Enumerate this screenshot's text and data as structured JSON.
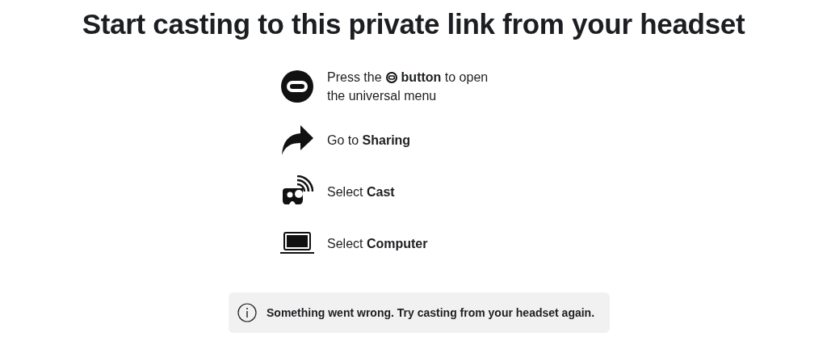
{
  "title": "Start casting to this private link from your headset",
  "steps": [
    {
      "kind": "headset-button",
      "text_before": "Press the",
      "text": "**button** to open",
      "text_after": "the universal menu"
    },
    {
      "kind": "share",
      "text": "Go to **Sharing**"
    },
    {
      "kind": "cast",
      "text": "Select **Cast**"
    },
    {
      "kind": "computer",
      "text": "Select **Computer**"
    }
  ],
  "alert": {
    "text": "Something went wrong. Try casting from your headset again."
  }
}
